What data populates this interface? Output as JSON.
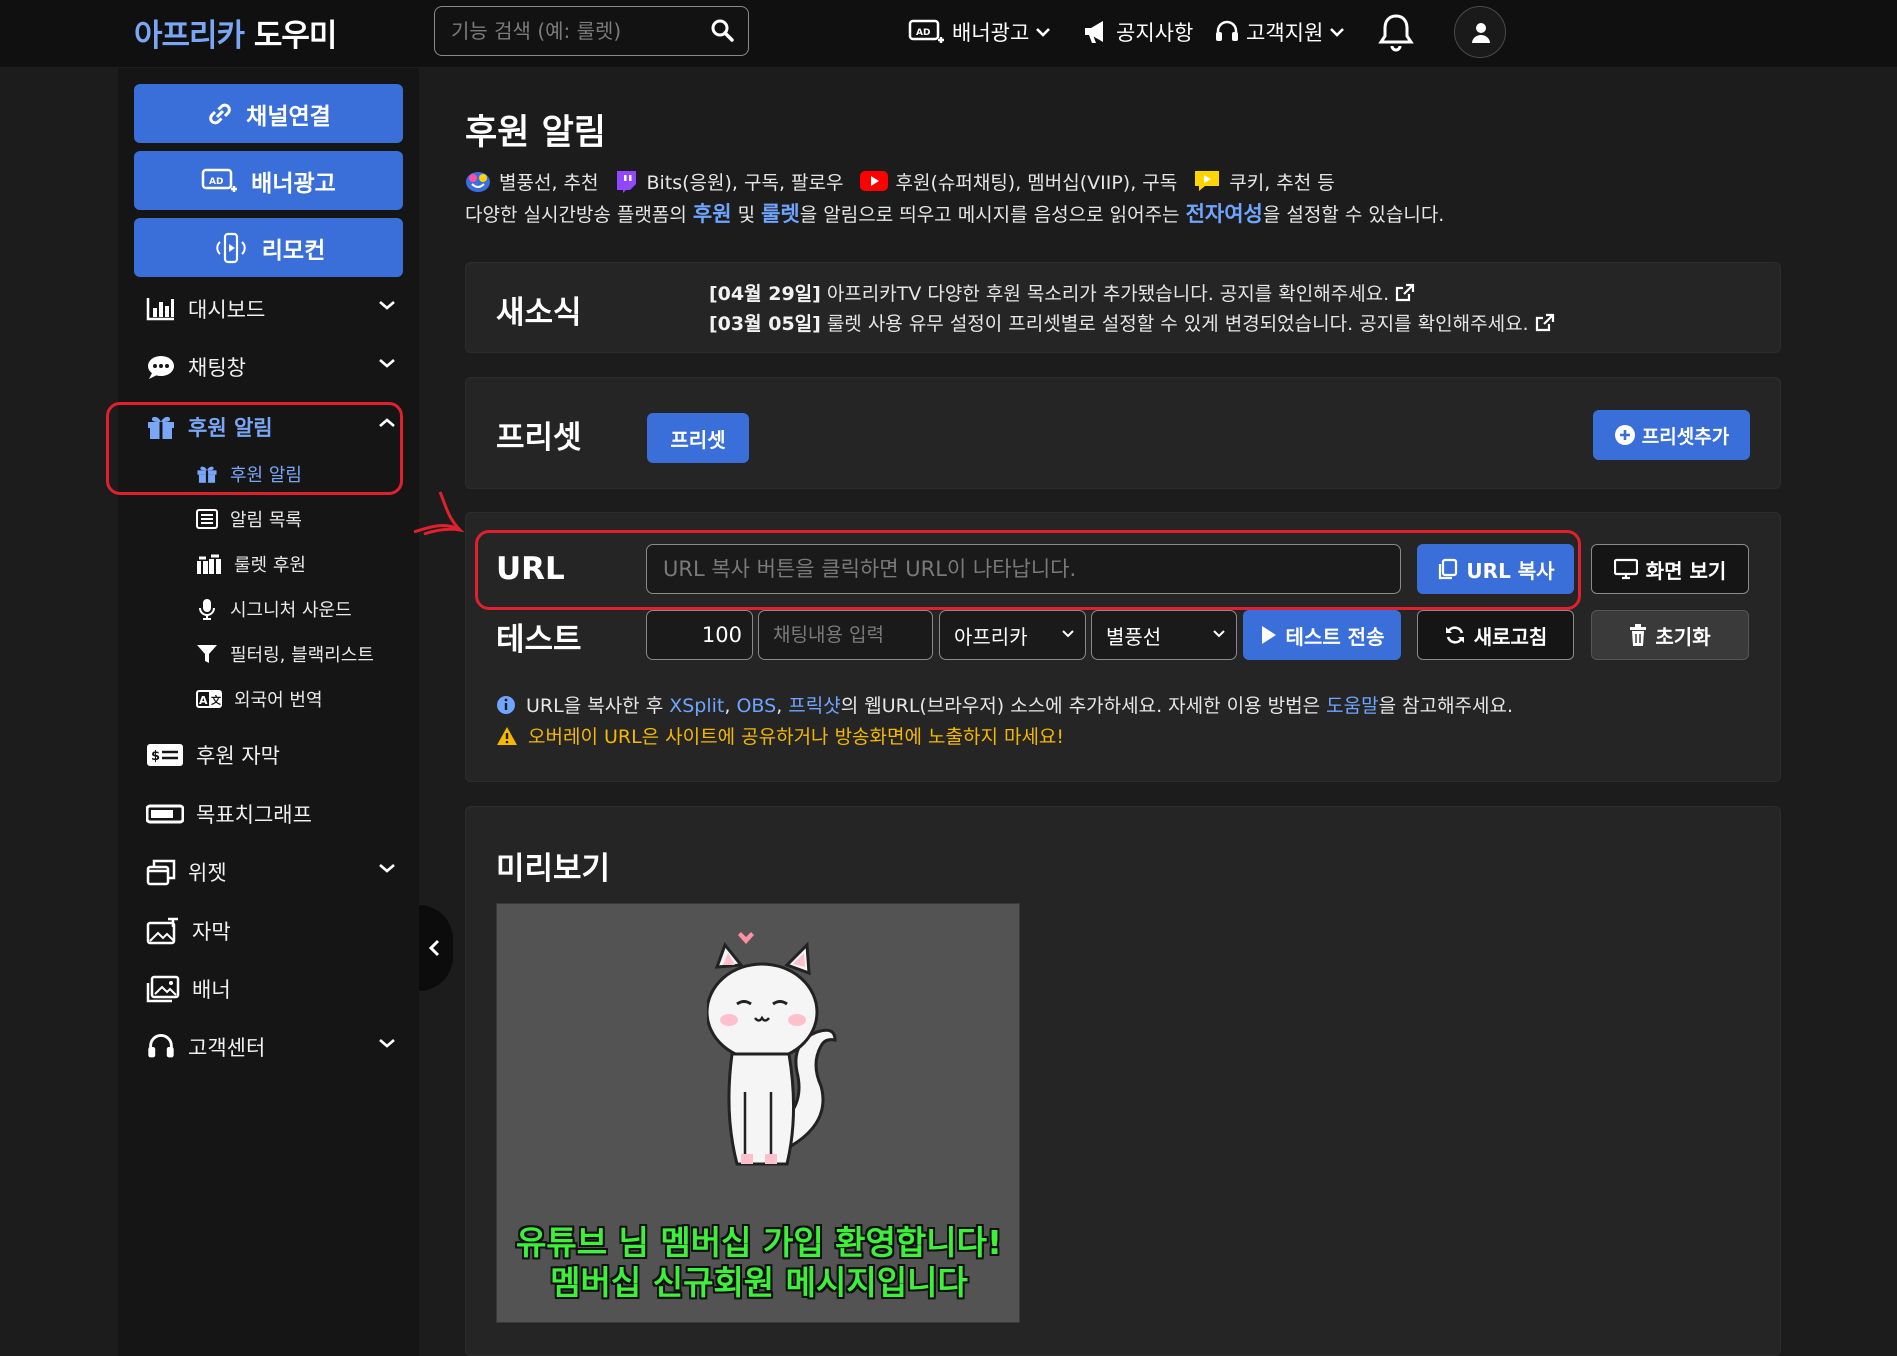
{
  "header": {
    "logo_part1": "아프리카",
    "logo_part2": "도우미",
    "search_placeholder": "기능 검색 (예: 룰렛)",
    "nav": {
      "banner_ad": "배너광고",
      "notice": "공지사항",
      "support": "고객지원"
    }
  },
  "sidebar": {
    "buttons": {
      "channel_connect": "채널연결",
      "banner_ad": "배너광고",
      "remote": "리모컨"
    },
    "items": {
      "dashboard": "대시보드",
      "chat": "채팅창",
      "donation_alert": "후원 알림",
      "donation_subtitle": "후원 자막",
      "goal_graph": "목표치그래프",
      "widget": "위젯",
      "subtitle": "자막",
      "banner": "배너",
      "customer_center": "고객센터"
    },
    "sub_items": {
      "donation_alert": "후원 알림",
      "alert_list": "알림 목록",
      "roulette_donation": "룰렛 후원",
      "signature_sound": "시그니처 사운드",
      "filtering": "필터링, 블랙리스트",
      "translation": "외국어 번역"
    }
  },
  "page": {
    "title": "후원 알림",
    "platforms": {
      "afreeca": "별풍선, 추천",
      "twitch": "Bits(응원), 구독, 팔로우",
      "youtube": "후원(슈퍼채팅), 멤버십(VIIP), 구독",
      "kakao": "쿠키, 추천 등"
    },
    "description": {
      "p1": "다양한 실시간방송 플랫폼의 ",
      "hl1": "후원",
      "p2": " 및 ",
      "hl2": "룰렛",
      "p3": "을 알림으로 띄우고 메시지를 음성으로 읽어주는 ",
      "hl3": "전자여성",
      "p4": "을 설정할 수 있습니다."
    }
  },
  "news": {
    "title": "새소식",
    "items": [
      {
        "date": "[04월 29일]",
        "text": "아프리카TV 다양한 후원 목소리가 추가됐습니다. 공지를 확인해주세요."
      },
      {
        "date": "[03월 05일]",
        "text": "룰렛 사용 유무 설정이 프리셋별로 설정할 수 있게 변경되었습니다. 공지를 확인해주세요."
      }
    ]
  },
  "preset": {
    "title": "프리셋",
    "current": "프리셋",
    "add_label": "프리셋추가"
  },
  "url_section": {
    "label": "URL",
    "placeholder": "URL 복사 버튼을 클릭하면 URL이 나타납니다.",
    "copy_label": "URL 복사",
    "view_label": "화면 보기"
  },
  "test_section": {
    "label": "테스트",
    "amount": "100",
    "chat_placeholder": "채팅내용 입력",
    "platform": "아프리카",
    "type": "별풍선",
    "send_label": "테스트 전송",
    "refresh_label": "새로고침",
    "reset_label": "초기화"
  },
  "info": {
    "p1": "URL을 복사한 후 ",
    "xsplit": "XSplit",
    "sep": ", ",
    "obs": "OBS",
    "sep2": ", ",
    "prism": "프릭샷",
    "p2": "의 웹URL(브라우저) 소스에 추가하세요. 자세한 이용 방법은 ",
    "help": "도움말",
    "p3": "을 참고해주세요.",
    "warning": "오버레이 URL은 사이트에 공유하거나 방송화면에 노출하지 마세요!"
  },
  "preview": {
    "title": "미리보기",
    "message_line1": "유튜브 님 멤버십 가입 환영합니다!",
    "message_line2": "멤버십 신규회원 메시지입니다"
  },
  "colors": {
    "accent": "#3a6fd9",
    "link": "#6fa4ff",
    "highlight_red": "#e0202e",
    "warning": "#f5b800",
    "preview_text": "#3ef03a"
  }
}
